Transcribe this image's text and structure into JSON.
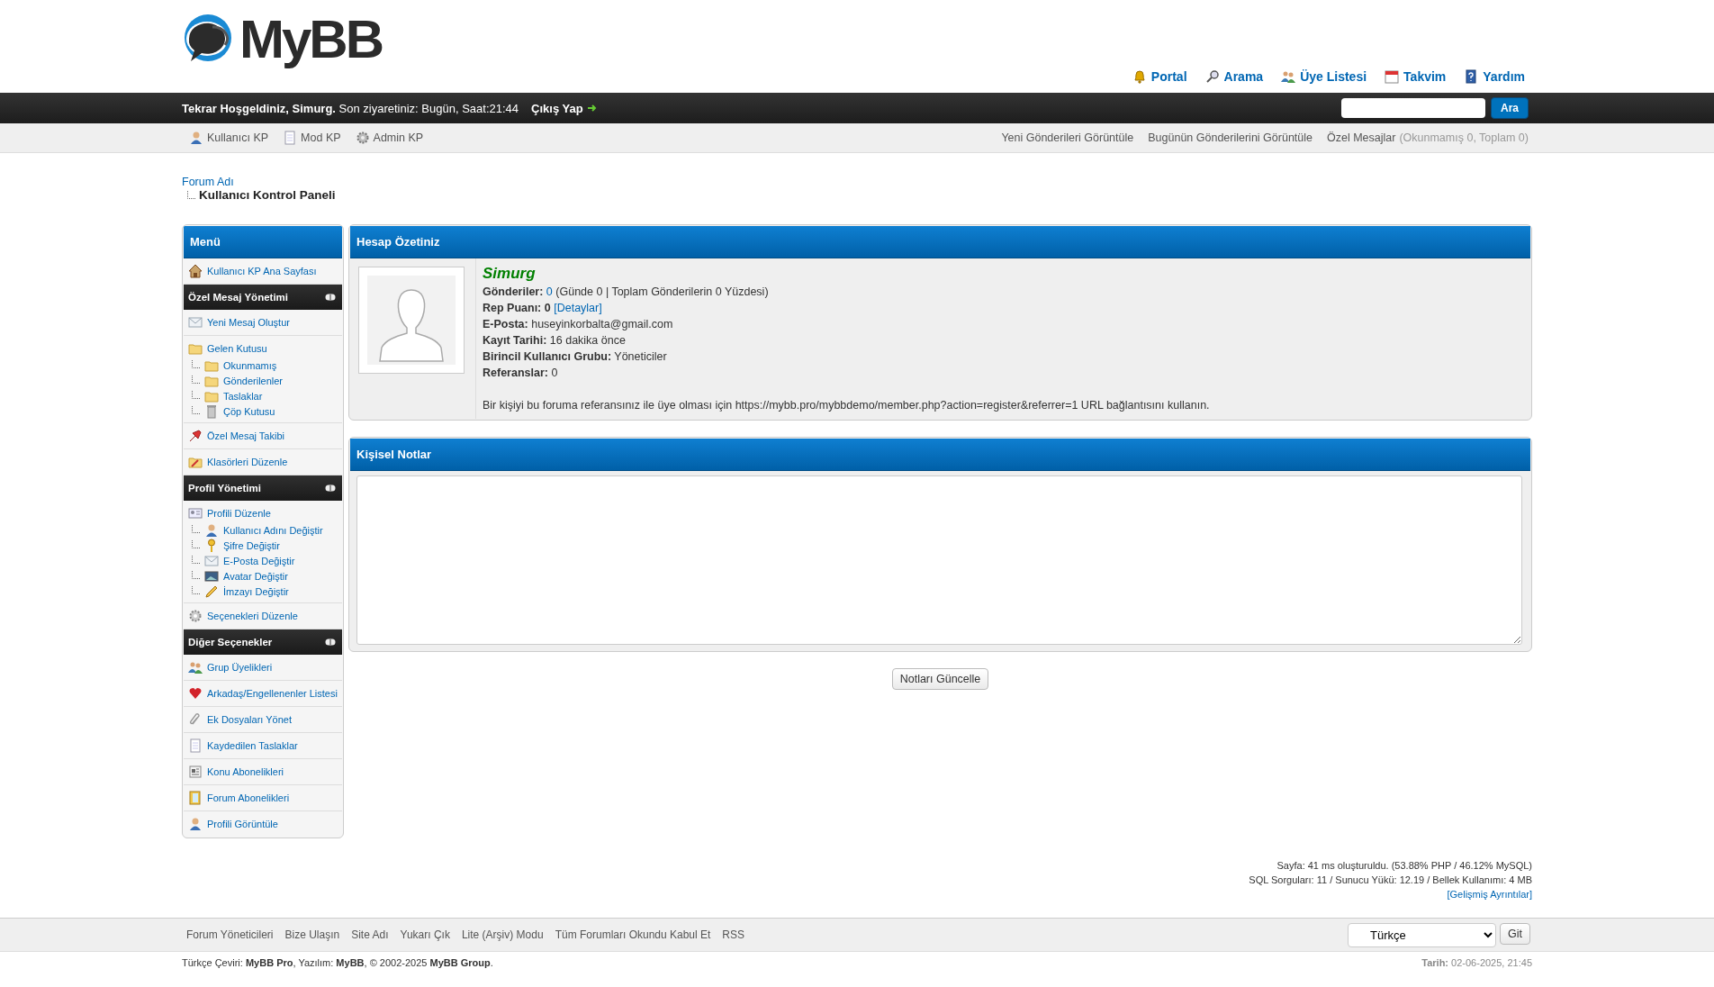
{
  "logo": {
    "text": "MyBB"
  },
  "top_links": [
    "Portal",
    "Arama",
    "Üye Listesi",
    "Takvim",
    "Yardım"
  ],
  "welcome_bar": {
    "greeting": "**Tekrar Hoşgeldiniz, Simurg.** Son ziyaretiniz: Bugün, Saat:21:44",
    "logout": "Çıkış Yap",
    "search_button": "Ara"
  },
  "panel_bar": {
    "left": [
      "Kullanıcı KP",
      "Mod KP",
      "Admin KP"
    ],
    "right": [
      "Yeni Gönderileri Görüntüle",
      "Bugünün Gönderilerini Görüntüle"
    ],
    "messages": {
      "label": "Özel Mesajlar",
      "counts": "(Okunmamış 0, Toplam 0)"
    }
  },
  "breadcrumb": [
    "Forum Adı",
    "Kullanıcı Kontrol Paneli"
  ],
  "menu": {
    "title": "Menü",
    "home": "Kullanıcı KP Ana Sayfası",
    "sections": [
      {
        "title": "Özel Mesaj Yönetimi",
        "items": [
          {
            "label": "Yeni Mesaj Oluştur"
          },
          {
            "label": "Gelen Kutusu",
            "children": [
              {
                "label": "Okunmamış"
              },
              {
                "label": "Gönderilenler"
              },
              {
                "label": "Taslaklar"
              },
              {
                "label": "Çöp Kutusu"
              }
            ]
          },
          {
            "label": "Özel Mesaj Takibi"
          },
          {
            "label": "Klasörleri Düzenle"
          }
        ]
      },
      {
        "title": "Profil Yönetimi",
        "items": [
          {
            "label": "Profili Düzenle",
            "children": [
              {
                "label": "Kullanıcı Adını Değiştir"
              },
              {
                "label": "Şifre Değiştir"
              },
              {
                "label": "E-Posta Değiştir"
              },
              {
                "label": "Avatar Değiştir"
              },
              {
                "label": "İmzayı Değiştir"
              }
            ]
          },
          {
            "label": "Seçenekleri Düzenle"
          }
        ]
      },
      {
        "title": "Diğer Seçenekler",
        "items": [
          {
            "label": "Grup Üyelikleri"
          },
          {
            "label": "Arkadaş/Engellenenler Listesi"
          },
          {
            "label": "Ek Dosyaları Yönet"
          },
          {
            "label": "Kaydedilen Taslaklar"
          },
          {
            "label": "Konu Abonelikleri"
          },
          {
            "label": "Forum Abonelikleri"
          },
          {
            "label": "Profili Görüntüle"
          }
        ]
      }
    ]
  },
  "summary": {
    "title": "Hesap Özetiniz",
    "username": "Simurg",
    "fields": [
      {
        "label": "Gönderiler:",
        "link": "0",
        "value": "(Günde 0 | Toplam Gönderilerin 0 Yüzdesi)"
      },
      {
        "label": "Rep Puanı: 0",
        "link": "[Detaylar]"
      },
      {
        "label": "E-Posta:",
        "value": "huseyinkorbalta@gmail.com"
      },
      {
        "label": "Kayıt Tarihi:",
        "value": "16 dakika önce"
      },
      {
        "label": "Birincil Kullanıcı Grubu:",
        "value": "Yöneticiler"
      },
      {
        "label": "Referanslar:",
        "value": "0"
      }
    ],
    "referral": "Bir kişiyi bu foruma referansınız ile üye olması için https://mybb.pro/mybbdemo/member.php?action=register&referrer=1 URL bağlantısını kullanın."
  },
  "notes": {
    "title": "Kişisel Notlar",
    "button": "Notları Güncelle"
  },
  "debug": {
    "lines": [
      "Sayfa: 41 ms oluşturuldu. (53.88% PHP / 46.12% MySQL)",
      "SQL Sorguları: 11 / Sunucu Yükü: 12.19 / Bellek Kullanımı: 4 MB"
    ],
    "link": "[Gelişmiş Ayrıntılar]"
  },
  "footer": {
    "links": [
      "Forum Yöneticileri",
      "Bize Ulaşın",
      "Site Adı",
      "Yukarı Çık",
      "Lite (Arşiv) Modu",
      "Tüm Forumları Okundu Kabul Et",
      "RSS"
    ],
    "language": "Türkçe",
    "go_button": "Git"
  },
  "copyright": "Türkçe Çeviri: **MyBB Pro**, Yazılım: **MyBB**, © 2002-2025 **MyBB Group**.",
  "date": "**Tarih:** 02-06-2025, 21:45"
}
